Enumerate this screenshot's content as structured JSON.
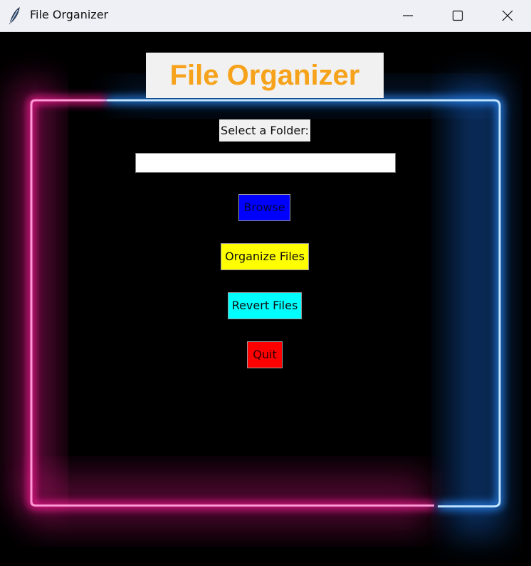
{
  "window": {
    "title": "File Organizer",
    "app_icon": "feather-icon",
    "controls": [
      "minimize-icon",
      "maximize-icon",
      "close-icon"
    ]
  },
  "app": {
    "heading": "File Organizer",
    "folder_label": "Select a Folder:",
    "folder_value": "",
    "buttons": {
      "browse": "Browse",
      "organize": "Organize Files",
      "revert": "Revert Files",
      "quit": "Quit"
    }
  },
  "colors": {
    "heading_text": "#f6a21a",
    "browse_bg": "#0000ff",
    "organize_bg": "#ffff00",
    "revert_bg": "#00ffff",
    "quit_bg": "#ff0000",
    "neon_pink": "#ff2aa8",
    "neon_blue": "#3aa8ff"
  }
}
